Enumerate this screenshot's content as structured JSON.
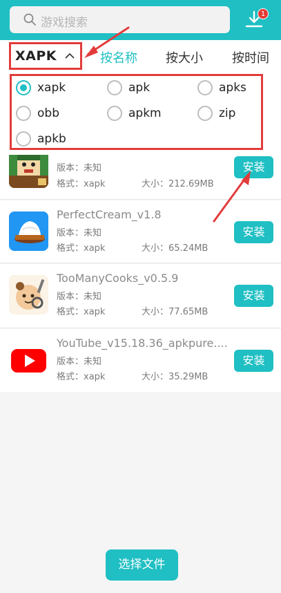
{
  "header": {
    "search_placeholder": "游戏搜索",
    "search_icon": "search-icon",
    "download_icon": "download-icon",
    "download_badge": "1"
  },
  "sortbar": {
    "type_label": "XAPK",
    "tabs": [
      {
        "label": "按名称",
        "active": true
      },
      {
        "label": "按大小",
        "active": false
      },
      {
        "label": "按时间",
        "active": false
      }
    ]
  },
  "filter": {
    "options": [
      {
        "label": "xapk",
        "checked": true
      },
      {
        "label": "apk",
        "checked": false
      },
      {
        "label": "apks",
        "checked": false
      },
      {
        "label": "obb",
        "checked": false
      },
      {
        "label": "apkm",
        "checked": false
      },
      {
        "label": "zip",
        "checked": false
      },
      {
        "label": "apkb",
        "checked": false
      }
    ]
  },
  "apps": [
    {
      "name": "",
      "version_label": "版本：未知",
      "format_label": "格式：xapk",
      "size_label": "大小：212.69MB",
      "install_label": "安装"
    },
    {
      "name": "PerfectCream_v1.8",
      "version_label": "版本：未知",
      "format_label": "格式：xapk",
      "size_label": "大小：65.24MB",
      "install_label": "安装"
    },
    {
      "name": "TooManyCooks_v0.5.9",
      "version_label": "版本：未知",
      "format_label": "格式：xapk",
      "size_label": "大小：77.65MB",
      "install_label": "安装"
    },
    {
      "name": "YouTube_v15.18.36_apkpure....",
      "version_label": "版本：未知",
      "format_label": "格式：xapk",
      "size_label": "大小：35.29MB",
      "install_label": "安装"
    }
  ],
  "bottom": {
    "choose_file_label": "选择文件"
  },
  "colors": {
    "accent": "#1fbfc3",
    "annotation": "#e33b3b"
  }
}
